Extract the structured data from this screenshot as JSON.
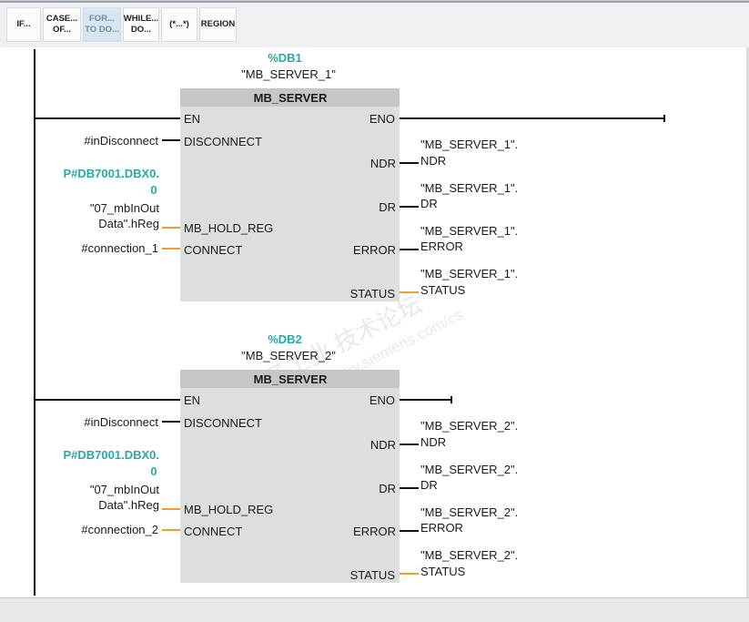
{
  "toolbar": {
    "buttons": [
      {
        "line1": "IF...",
        "line2": ""
      },
      {
        "line1": "CASE...",
        "line2": "OF..."
      },
      {
        "line1": "FOR...",
        "line2": "TO DO..."
      },
      {
        "line1": "WHILE...",
        "line2": "DO..."
      },
      {
        "line1": "(*...*)",
        "line2": ""
      },
      {
        "line1": "REGION",
        "line2": ""
      }
    ]
  },
  "blocks": [
    {
      "db_name": "%DB1",
      "instance": "\"MB_SERVER_1\"",
      "type": "MB_SERVER",
      "in_pins": [
        "EN",
        "DISCONNECT",
        "MB_HOLD_REG",
        "CONNECT"
      ],
      "out_pins": [
        "ENO",
        "NDR",
        "DR",
        "ERROR",
        "STATUS"
      ],
      "disconnect_operand": "#inDisconnect",
      "hold_reg_pointer": [
        "P#DB7001.DBX0.",
        "0"
      ],
      "hold_reg_operand": [
        "\"07_mbInOut",
        "Data\".hReg"
      ],
      "connect_operand": "#connection_1",
      "outputs": [
        {
          "line1": "\"MB_SERVER_1\".",
          "line2": "NDR"
        },
        {
          "line1": "\"MB_SERVER_1\".",
          "line2": "DR"
        },
        {
          "line1": "\"MB_SERVER_1\".",
          "line2": "ERROR"
        },
        {
          "line1": "\"MB_SERVER_1\".",
          "line2": "STATUS"
        }
      ]
    },
    {
      "db_name": "%DB2",
      "instance": "\"MB_SERVER_2\"",
      "type": "MB_SERVER",
      "in_pins": [
        "EN",
        "DISCONNECT",
        "MB_HOLD_REG",
        "CONNECT"
      ],
      "out_pins": [
        "ENO",
        "NDR",
        "DR",
        "ERROR",
        "STATUS"
      ],
      "disconnect_operand": "#inDisconnect",
      "hold_reg_pointer": [
        "P#DB7001.DBX0.",
        "0"
      ],
      "hold_reg_operand": [
        "\"07_mbInOut",
        "Data\".hReg"
      ],
      "connect_operand": "#connection_2",
      "outputs": [
        {
          "line1": "\"MB_SERVER_2\".",
          "line2": "NDR"
        },
        {
          "line1": "\"MB_SERVER_2\".",
          "line2": "DR"
        },
        {
          "line1": "\"MB_SERVER_2\".",
          "line2": "ERROR"
        },
        {
          "line1": "\"MB_SERVER_2\".",
          "line2": "STATUS"
        }
      ]
    }
  ],
  "watermark": {
    "line1": "西门子工业 技术论坛",
    "line2": "support.industry.siemens.com/cs"
  },
  "colors": {
    "block_fill": "#dcdee0",
    "block_header": "#c4c7ca",
    "wire": "#111111",
    "orange_wire": "#f0a020",
    "db_teal": "#2aa8a8"
  }
}
